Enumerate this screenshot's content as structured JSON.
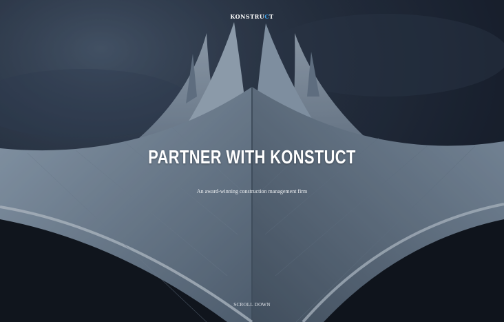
{
  "brand": {
    "logo_prefix": "KONSTRU",
    "logo_accent": "C",
    "logo_suffix": "T",
    "accent_color": "#3fa9f5"
  },
  "hero": {
    "headline": "PARTNER WITH KONSTUCT",
    "subline": "An award-winning construction management firm",
    "scroll_label": "SCROLL DOWN",
    "background_image": "tensile-roof-architecture-photo"
  }
}
